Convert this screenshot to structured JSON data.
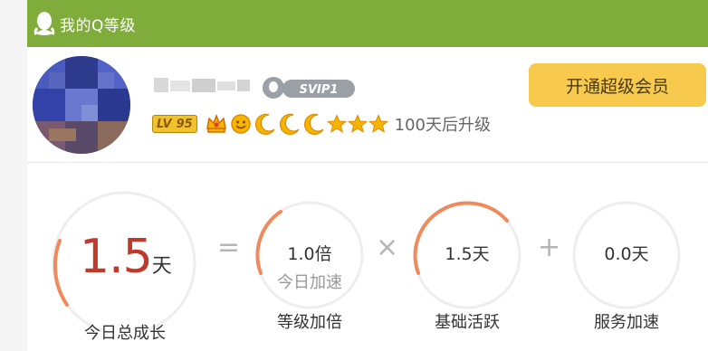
{
  "header": {
    "title": "我的Q等级"
  },
  "profile": {
    "svip_label": "SVIP1",
    "open_button": "开通超级会员",
    "level_prefix": "LV",
    "level": "95",
    "upgrade_text": "100天后升级",
    "level_icons": [
      "crown-icon",
      "sun-icon",
      "moon-icon",
      "moon-icon",
      "moon-icon",
      "star-icon",
      "star-icon",
      "star-icon"
    ]
  },
  "formula": {
    "total": {
      "value_num": "1.5",
      "unit": "天",
      "label": "今日总成长"
    },
    "equals": "=",
    "times": "×",
    "plus": "+",
    "multiplier": {
      "value": "1.0倍",
      "sub": "今日加速",
      "label": "等级加倍"
    },
    "base": {
      "value": "1.5天",
      "label": "基础活跃"
    },
    "service": {
      "value": "0.0天",
      "label": "服务加速"
    }
  },
  "colors": {
    "header": "#7fac3a",
    "button": "#f7c94d",
    "accent": "#f08a5d",
    "big_number": "#c0392b"
  }
}
